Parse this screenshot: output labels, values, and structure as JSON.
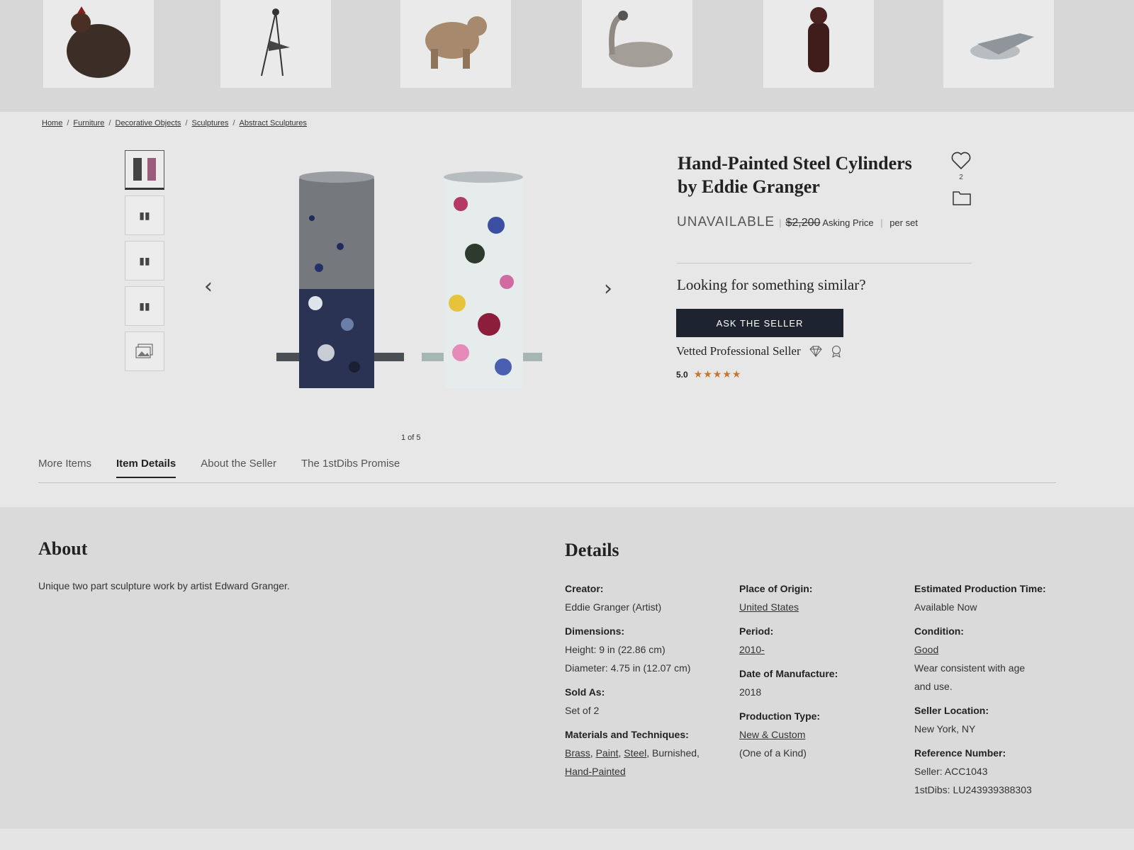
{
  "strip": {
    "items": [
      {
        "name": "hen-figure"
      },
      {
        "name": "heron-figure"
      },
      {
        "name": "elephant-figure"
      },
      {
        "name": "swan-figure"
      },
      {
        "name": "bear-figure"
      },
      {
        "name": "bird-figure"
      }
    ]
  },
  "breadcrumb": [
    "Home",
    "Furniture",
    "Decorative Objects",
    "Sculptures",
    "Abstract Sculptures"
  ],
  "gallery": {
    "counter": "1 of 5",
    "prev_icon": "chevron-left-icon",
    "next_icon": "chevron-right-icon"
  },
  "product": {
    "title": "Hand-Painted Steel Cylinders by Eddie Granger",
    "favorite_count": "2",
    "status": "UNAVAILABLE",
    "old_price": "$2,200",
    "price_label": "Asking Price",
    "price_unit": "per set"
  },
  "seller": {
    "similar_heading": "Looking for something similar?",
    "ask_button": "ASK THE SELLER",
    "vetted_label": "Vetted Professional Seller",
    "rating": "5.0",
    "stars": 5
  },
  "tabs": [
    "More Items",
    "Item Details",
    "About the Seller",
    "The 1stDibs Promise"
  ],
  "about": {
    "heading": "About",
    "text": "Unique two part sculpture work by artist Edward Granger."
  },
  "details": {
    "heading": "Details",
    "creator_label": "Creator:",
    "creator_value": "Eddie Granger (Artist)",
    "dimensions_label": "Dimensions:",
    "height": "Height: 9 in (22.86 cm)",
    "diameter": "Diameter: 4.75 in (12.07 cm)",
    "sold_as_label": "Sold As:",
    "sold_as_value": "Set of 2",
    "materials_label": "Materials and Techniques:",
    "mat_brass": "Brass",
    "mat_paint": "Paint",
    "mat_steel": "Steel",
    "mat_burnished": "Burnished",
    "mat_handpainted": "Hand-Painted",
    "origin_label": "Place of Origin:",
    "origin_value": "United States",
    "period_label": "Period:",
    "period_value": "2010-",
    "manufacture_label": "Date of Manufacture:",
    "manufacture_value": "2018",
    "production_label": "Production Type:",
    "production_value": "New & Custom",
    "production_note": "(One of a Kind)",
    "est_time_label": "Estimated Production Time:",
    "est_time_value": "Available Now",
    "condition_label": "Condition:",
    "condition_value": "Good",
    "condition_note": "Wear consistent with age and use.",
    "location_label": "Seller Location:",
    "location_value": "New York, NY",
    "reference_label": "Reference Number:",
    "ref_seller": "Seller: ACC1043",
    "ref_1stdibs": "1stDibs: LU243939388303"
  },
  "colors": {
    "page_bg": "#e3e4e3",
    "button_bg": "#1d2430",
    "star": "#c8752c"
  }
}
